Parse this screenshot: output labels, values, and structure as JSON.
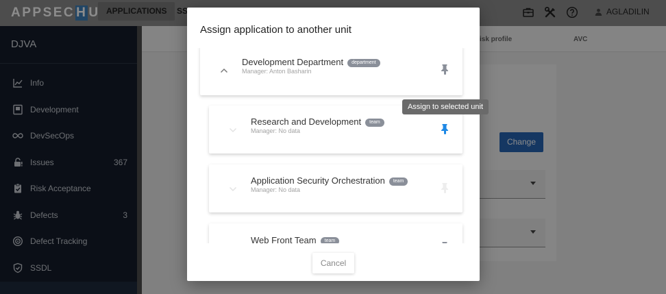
{
  "header": {
    "logo_left": "APPSEC",
    "logo_mid": "H",
    "logo_right": "UB",
    "nav_active": "APPLICATIONS",
    "nav_next": "SS",
    "user_name": "AGLADILIN",
    "icons": [
      "briefcase-icon",
      "tools-icon",
      "help-circle-icon",
      "user-icon"
    ]
  },
  "sidebar": {
    "title": "DJVA",
    "items": [
      {
        "label": "Info",
        "icon": "chart-line-icon",
        "count": ""
      },
      {
        "label": "Development",
        "icon": "code-file-icon",
        "count": ""
      },
      {
        "label": "DevSecOps",
        "icon": "infinity-icon",
        "count": ""
      },
      {
        "label": "Issues",
        "icon": "lock-warning-icon",
        "count": "367"
      },
      {
        "label": "Risk Acceptance",
        "icon": "clipboard-check-icon",
        "count": ""
      },
      {
        "label": "Defects",
        "icon": "bug-icon",
        "count": "3"
      },
      {
        "label": "Defect Tracking",
        "icon": "target-icon",
        "count": ""
      },
      {
        "label": "SSDL",
        "icon": "shield-check-icon",
        "count": ""
      }
    ]
  },
  "background": {
    "tab_risk_profile": "isk profile",
    "tab_avc": "AVC",
    "change_button": "Change"
  },
  "modal": {
    "title": "Assign application to another unit",
    "units": [
      {
        "name": "Development Department",
        "badge": "department",
        "manager": "Manager: Anton Basharin"
      },
      {
        "name": "Research and Development",
        "badge": "team",
        "manager": "Manager: No data"
      },
      {
        "name": "Application Security Orchestration",
        "badge": "team",
        "manager": "Manager: No data"
      },
      {
        "name": "Web Front Team",
        "badge": "team",
        "manager": ""
      }
    ],
    "cancel_label": "Cancel",
    "tooltip": "Assign to selected unit"
  },
  "colors": {
    "accent_blue": "#1e88e5",
    "change_button": "#2765b3",
    "sidebar_bg": "#141d2b"
  }
}
